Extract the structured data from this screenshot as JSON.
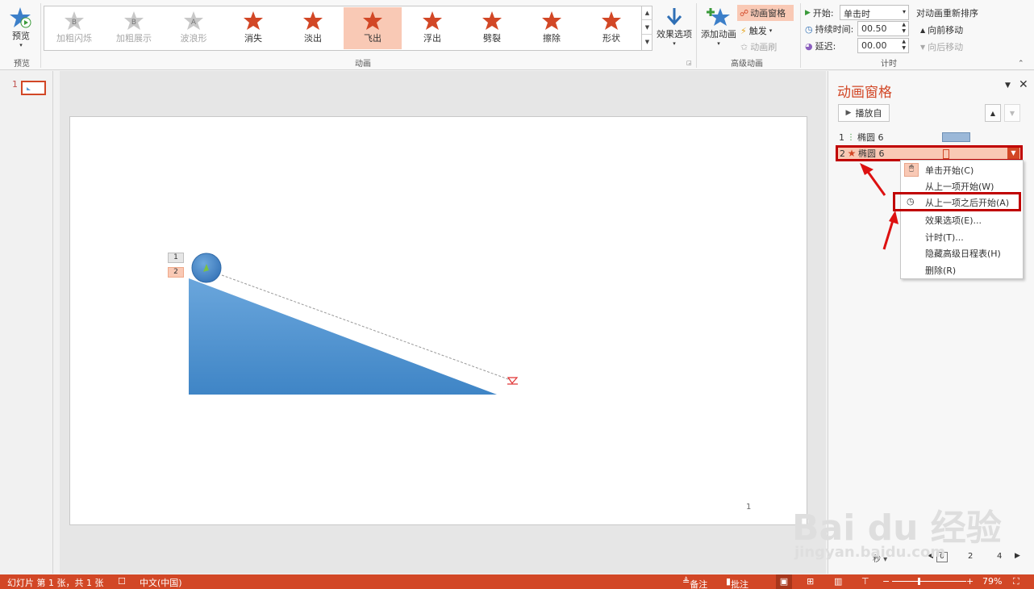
{
  "ribbon": {
    "preview_label": "预览",
    "preview_group": "预览",
    "gallery": [
      {
        "label": "加粗闪烁",
        "letter": "B",
        "disabled": true
      },
      {
        "label": "加粗展示",
        "letter": "B",
        "disabled": true
      },
      {
        "label": "波浪形",
        "letter": "A",
        "disabled": true
      },
      {
        "label": "消失",
        "disabled": false
      },
      {
        "label": "淡出",
        "disabled": false
      },
      {
        "label": "飞出",
        "disabled": false,
        "selected": true
      },
      {
        "label": "浮出",
        "disabled": false
      },
      {
        "label": "劈裂",
        "disabled": false
      },
      {
        "label": "擦除",
        "disabled": false
      },
      {
        "label": "形状",
        "disabled": false
      }
    ],
    "effect_options": "效果选项",
    "animation_group": "动画",
    "add_animation": "添加动画",
    "animation_pane": "动画窗格",
    "trigger": "触发",
    "animation_painter": "动画刷",
    "advanced_group": "高级动画",
    "start_label": "开始:",
    "start_value": "单击时",
    "duration_label": "持续时间:",
    "duration_value": "00.50",
    "delay_label": "延迟:",
    "delay_value": "00.00",
    "reorder_title": "对动画重新排序",
    "move_earlier": "向前移动",
    "move_later": "向后移动",
    "timing_group": "计时"
  },
  "thumbs": {
    "slide_number": "1"
  },
  "slide": {
    "anim_tag_1": "1",
    "anim_tag_2": "2",
    "page_number": "1"
  },
  "pane": {
    "title": "动画窗格",
    "play_button": "播放自",
    "rows": [
      {
        "index": "1",
        "name": "椭圆 6"
      },
      {
        "index": "2",
        "name": "椭圆 6"
      }
    ],
    "menu": [
      "单击开始(C)",
      "从上一项开始(W)",
      "从上一项之后开始(A)",
      "效果选项(E)...",
      "计时(T)...",
      "隐藏高级日程表(H)",
      "删除(R)"
    ],
    "scroll_page": "2",
    "scroll_page_2": "4"
  },
  "status": {
    "slide_info": "幻灯片 第 1 张，共 1 张",
    "language": "中文(中国)",
    "notes": "备注",
    "comments": "批注",
    "zoom": "79%"
  },
  "watermark": {
    "brand": "Bai du 经验",
    "url": "jingyan.baidu.com"
  },
  "colors": {
    "accent": "#d24726",
    "selection": "#f9c9b5",
    "shape_blue": "#5b9bd5",
    "highlight_box": "#c00000"
  }
}
